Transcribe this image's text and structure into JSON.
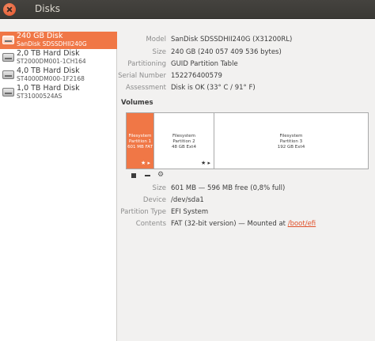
{
  "window": {
    "title": "Disks"
  },
  "sidebar": {
    "items": [
      {
        "name": "240 GB Disk",
        "model": "SanDisk SDSSDHII240G",
        "selected": true
      },
      {
        "name": "2,0 TB Hard Disk",
        "model": "ST2000DM001-1CH164",
        "selected": false
      },
      {
        "name": "4,0 TB Hard Disk",
        "model": "ST4000DM000-1F2168",
        "selected": false
      },
      {
        "name": "1,0 TB Hard Disk",
        "model": "ST31000524AS",
        "selected": false
      }
    ]
  },
  "disk": {
    "model_label": "Model",
    "model": "SanDisk SDSSDHII240G (X31200RL)",
    "size_label": "Size",
    "size": "240 GB (240 057 409 536 bytes)",
    "partitioning_label": "Partitioning",
    "partitioning": "GUID Partition Table",
    "serial_label": "Serial Number",
    "serial": "152276400579",
    "assessment_label": "Assessment",
    "assessment": "Disk is OK (33° C / 91° F)"
  },
  "volumes": {
    "title": "Volumes",
    "partitions": [
      {
        "line1": "Filesystem",
        "line2": "Partition 1",
        "line3": "601 MB FAT",
        "selected": true,
        "icons": "★ ▸"
      },
      {
        "line1": "Filesystem",
        "line2": "Partition 2",
        "line3": "48 GB Ext4",
        "selected": false,
        "icons": "★ ▸"
      },
      {
        "line1": "Filesystem",
        "line2": "Partition 3",
        "line3": "192 GB Ext4",
        "selected": false,
        "icons": ""
      }
    ]
  },
  "partition": {
    "size_label": "Size",
    "size": "601 MB — 596 MB free (0,8% full)",
    "device_label": "Device",
    "device": "/dev/sda1",
    "type_label": "Partition Type",
    "type": "EFI System",
    "contents_label": "Contents",
    "contents_prefix": "FAT (32-bit version) — Mounted at ",
    "contents_link": "/boot/efi"
  }
}
